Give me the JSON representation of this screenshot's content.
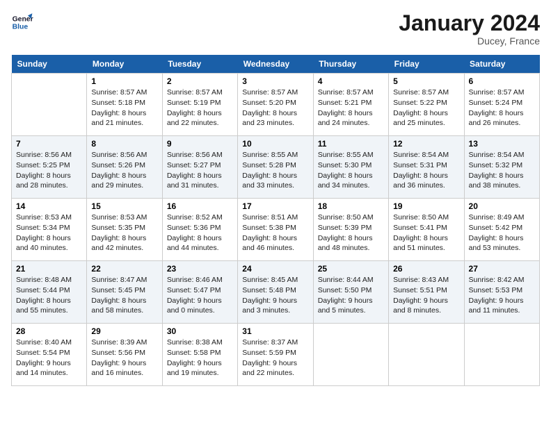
{
  "logo": {
    "line1": "General",
    "line2": "Blue"
  },
  "title": "January 2024",
  "location": "Ducey, France",
  "days_of_week": [
    "Sunday",
    "Monday",
    "Tuesday",
    "Wednesday",
    "Thursday",
    "Friday",
    "Saturday"
  ],
  "weeks": [
    [
      {
        "day": "",
        "sunrise": "",
        "sunset": "",
        "daylight": ""
      },
      {
        "day": "1",
        "sunrise": "Sunrise: 8:57 AM",
        "sunset": "Sunset: 5:18 PM",
        "daylight": "Daylight: 8 hours and 21 minutes."
      },
      {
        "day": "2",
        "sunrise": "Sunrise: 8:57 AM",
        "sunset": "Sunset: 5:19 PM",
        "daylight": "Daylight: 8 hours and 22 minutes."
      },
      {
        "day": "3",
        "sunrise": "Sunrise: 8:57 AM",
        "sunset": "Sunset: 5:20 PM",
        "daylight": "Daylight: 8 hours and 23 minutes."
      },
      {
        "day": "4",
        "sunrise": "Sunrise: 8:57 AM",
        "sunset": "Sunset: 5:21 PM",
        "daylight": "Daylight: 8 hours and 24 minutes."
      },
      {
        "day": "5",
        "sunrise": "Sunrise: 8:57 AM",
        "sunset": "Sunset: 5:22 PM",
        "daylight": "Daylight: 8 hours and 25 minutes."
      },
      {
        "day": "6",
        "sunrise": "Sunrise: 8:57 AM",
        "sunset": "Sunset: 5:24 PM",
        "daylight": "Daylight: 8 hours and 26 minutes."
      }
    ],
    [
      {
        "day": "7",
        "sunrise": "Sunrise: 8:56 AM",
        "sunset": "Sunset: 5:25 PM",
        "daylight": "Daylight: 8 hours and 28 minutes."
      },
      {
        "day": "8",
        "sunrise": "Sunrise: 8:56 AM",
        "sunset": "Sunset: 5:26 PM",
        "daylight": "Daylight: 8 hours and 29 minutes."
      },
      {
        "day": "9",
        "sunrise": "Sunrise: 8:56 AM",
        "sunset": "Sunset: 5:27 PM",
        "daylight": "Daylight: 8 hours and 31 minutes."
      },
      {
        "day": "10",
        "sunrise": "Sunrise: 8:55 AM",
        "sunset": "Sunset: 5:28 PM",
        "daylight": "Daylight: 8 hours and 33 minutes."
      },
      {
        "day": "11",
        "sunrise": "Sunrise: 8:55 AM",
        "sunset": "Sunset: 5:30 PM",
        "daylight": "Daylight: 8 hours and 34 minutes."
      },
      {
        "day": "12",
        "sunrise": "Sunrise: 8:54 AM",
        "sunset": "Sunset: 5:31 PM",
        "daylight": "Daylight: 8 hours and 36 minutes."
      },
      {
        "day": "13",
        "sunrise": "Sunrise: 8:54 AM",
        "sunset": "Sunset: 5:32 PM",
        "daylight": "Daylight: 8 hours and 38 minutes."
      }
    ],
    [
      {
        "day": "14",
        "sunrise": "Sunrise: 8:53 AM",
        "sunset": "Sunset: 5:34 PM",
        "daylight": "Daylight: 8 hours and 40 minutes."
      },
      {
        "day": "15",
        "sunrise": "Sunrise: 8:53 AM",
        "sunset": "Sunset: 5:35 PM",
        "daylight": "Daylight: 8 hours and 42 minutes."
      },
      {
        "day": "16",
        "sunrise": "Sunrise: 8:52 AM",
        "sunset": "Sunset: 5:36 PM",
        "daylight": "Daylight: 8 hours and 44 minutes."
      },
      {
        "day": "17",
        "sunrise": "Sunrise: 8:51 AM",
        "sunset": "Sunset: 5:38 PM",
        "daylight": "Daylight: 8 hours and 46 minutes."
      },
      {
        "day": "18",
        "sunrise": "Sunrise: 8:50 AM",
        "sunset": "Sunset: 5:39 PM",
        "daylight": "Daylight: 8 hours and 48 minutes."
      },
      {
        "day": "19",
        "sunrise": "Sunrise: 8:50 AM",
        "sunset": "Sunset: 5:41 PM",
        "daylight": "Daylight: 8 hours and 51 minutes."
      },
      {
        "day": "20",
        "sunrise": "Sunrise: 8:49 AM",
        "sunset": "Sunset: 5:42 PM",
        "daylight": "Daylight: 8 hours and 53 minutes."
      }
    ],
    [
      {
        "day": "21",
        "sunrise": "Sunrise: 8:48 AM",
        "sunset": "Sunset: 5:44 PM",
        "daylight": "Daylight: 8 hours and 55 minutes."
      },
      {
        "day": "22",
        "sunrise": "Sunrise: 8:47 AM",
        "sunset": "Sunset: 5:45 PM",
        "daylight": "Daylight: 8 hours and 58 minutes."
      },
      {
        "day": "23",
        "sunrise": "Sunrise: 8:46 AM",
        "sunset": "Sunset: 5:47 PM",
        "daylight": "Daylight: 9 hours and 0 minutes."
      },
      {
        "day": "24",
        "sunrise": "Sunrise: 8:45 AM",
        "sunset": "Sunset: 5:48 PM",
        "daylight": "Daylight: 9 hours and 3 minutes."
      },
      {
        "day": "25",
        "sunrise": "Sunrise: 8:44 AM",
        "sunset": "Sunset: 5:50 PM",
        "daylight": "Daylight: 9 hours and 5 minutes."
      },
      {
        "day": "26",
        "sunrise": "Sunrise: 8:43 AM",
        "sunset": "Sunset: 5:51 PM",
        "daylight": "Daylight: 9 hours and 8 minutes."
      },
      {
        "day": "27",
        "sunrise": "Sunrise: 8:42 AM",
        "sunset": "Sunset: 5:53 PM",
        "daylight": "Daylight: 9 hours and 11 minutes."
      }
    ],
    [
      {
        "day": "28",
        "sunrise": "Sunrise: 8:40 AM",
        "sunset": "Sunset: 5:54 PM",
        "daylight": "Daylight: 9 hours and 14 minutes."
      },
      {
        "day": "29",
        "sunrise": "Sunrise: 8:39 AM",
        "sunset": "Sunset: 5:56 PM",
        "daylight": "Daylight: 9 hours and 16 minutes."
      },
      {
        "day": "30",
        "sunrise": "Sunrise: 8:38 AM",
        "sunset": "Sunset: 5:58 PM",
        "daylight": "Daylight: 9 hours and 19 minutes."
      },
      {
        "day": "31",
        "sunrise": "Sunrise: 8:37 AM",
        "sunset": "Sunset: 5:59 PM",
        "daylight": "Daylight: 9 hours and 22 minutes."
      },
      {
        "day": "",
        "sunrise": "",
        "sunset": "",
        "daylight": ""
      },
      {
        "day": "",
        "sunrise": "",
        "sunset": "",
        "daylight": ""
      },
      {
        "day": "",
        "sunrise": "",
        "sunset": "",
        "daylight": ""
      }
    ]
  ]
}
